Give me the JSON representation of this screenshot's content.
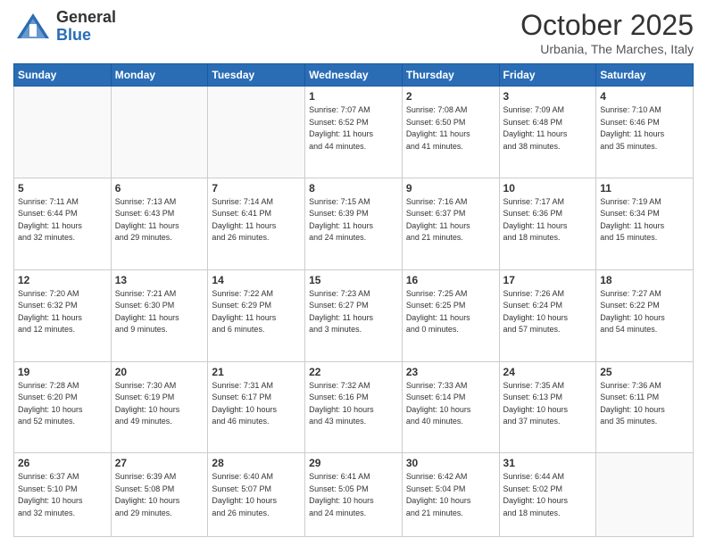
{
  "header": {
    "logo_general": "General",
    "logo_blue": "Blue",
    "month_title": "October 2025",
    "location": "Urbania, The Marches, Italy"
  },
  "days_of_week": [
    "Sunday",
    "Monday",
    "Tuesday",
    "Wednesday",
    "Thursday",
    "Friday",
    "Saturday"
  ],
  "weeks": [
    [
      {
        "day": "",
        "info": ""
      },
      {
        "day": "",
        "info": ""
      },
      {
        "day": "",
        "info": ""
      },
      {
        "day": "1",
        "info": "Sunrise: 7:07 AM\nSunset: 6:52 PM\nDaylight: 11 hours\nand 44 minutes."
      },
      {
        "day": "2",
        "info": "Sunrise: 7:08 AM\nSunset: 6:50 PM\nDaylight: 11 hours\nand 41 minutes."
      },
      {
        "day": "3",
        "info": "Sunrise: 7:09 AM\nSunset: 6:48 PM\nDaylight: 11 hours\nand 38 minutes."
      },
      {
        "day": "4",
        "info": "Sunrise: 7:10 AM\nSunset: 6:46 PM\nDaylight: 11 hours\nand 35 minutes."
      }
    ],
    [
      {
        "day": "5",
        "info": "Sunrise: 7:11 AM\nSunset: 6:44 PM\nDaylight: 11 hours\nand 32 minutes."
      },
      {
        "day": "6",
        "info": "Sunrise: 7:13 AM\nSunset: 6:43 PM\nDaylight: 11 hours\nand 29 minutes."
      },
      {
        "day": "7",
        "info": "Sunrise: 7:14 AM\nSunset: 6:41 PM\nDaylight: 11 hours\nand 26 minutes."
      },
      {
        "day": "8",
        "info": "Sunrise: 7:15 AM\nSunset: 6:39 PM\nDaylight: 11 hours\nand 24 minutes."
      },
      {
        "day": "9",
        "info": "Sunrise: 7:16 AM\nSunset: 6:37 PM\nDaylight: 11 hours\nand 21 minutes."
      },
      {
        "day": "10",
        "info": "Sunrise: 7:17 AM\nSunset: 6:36 PM\nDaylight: 11 hours\nand 18 minutes."
      },
      {
        "day": "11",
        "info": "Sunrise: 7:19 AM\nSunset: 6:34 PM\nDaylight: 11 hours\nand 15 minutes."
      }
    ],
    [
      {
        "day": "12",
        "info": "Sunrise: 7:20 AM\nSunset: 6:32 PM\nDaylight: 11 hours\nand 12 minutes."
      },
      {
        "day": "13",
        "info": "Sunrise: 7:21 AM\nSunset: 6:30 PM\nDaylight: 11 hours\nand 9 minutes."
      },
      {
        "day": "14",
        "info": "Sunrise: 7:22 AM\nSunset: 6:29 PM\nDaylight: 11 hours\nand 6 minutes."
      },
      {
        "day": "15",
        "info": "Sunrise: 7:23 AM\nSunset: 6:27 PM\nDaylight: 11 hours\nand 3 minutes."
      },
      {
        "day": "16",
        "info": "Sunrise: 7:25 AM\nSunset: 6:25 PM\nDaylight: 11 hours\nand 0 minutes."
      },
      {
        "day": "17",
        "info": "Sunrise: 7:26 AM\nSunset: 6:24 PM\nDaylight: 10 hours\nand 57 minutes."
      },
      {
        "day": "18",
        "info": "Sunrise: 7:27 AM\nSunset: 6:22 PM\nDaylight: 10 hours\nand 54 minutes."
      }
    ],
    [
      {
        "day": "19",
        "info": "Sunrise: 7:28 AM\nSunset: 6:20 PM\nDaylight: 10 hours\nand 52 minutes."
      },
      {
        "day": "20",
        "info": "Sunrise: 7:30 AM\nSunset: 6:19 PM\nDaylight: 10 hours\nand 49 minutes."
      },
      {
        "day": "21",
        "info": "Sunrise: 7:31 AM\nSunset: 6:17 PM\nDaylight: 10 hours\nand 46 minutes."
      },
      {
        "day": "22",
        "info": "Sunrise: 7:32 AM\nSunset: 6:16 PM\nDaylight: 10 hours\nand 43 minutes."
      },
      {
        "day": "23",
        "info": "Sunrise: 7:33 AM\nSunset: 6:14 PM\nDaylight: 10 hours\nand 40 minutes."
      },
      {
        "day": "24",
        "info": "Sunrise: 7:35 AM\nSunset: 6:13 PM\nDaylight: 10 hours\nand 37 minutes."
      },
      {
        "day": "25",
        "info": "Sunrise: 7:36 AM\nSunset: 6:11 PM\nDaylight: 10 hours\nand 35 minutes."
      }
    ],
    [
      {
        "day": "26",
        "info": "Sunrise: 6:37 AM\nSunset: 5:10 PM\nDaylight: 10 hours\nand 32 minutes."
      },
      {
        "day": "27",
        "info": "Sunrise: 6:39 AM\nSunset: 5:08 PM\nDaylight: 10 hours\nand 29 minutes."
      },
      {
        "day": "28",
        "info": "Sunrise: 6:40 AM\nSunset: 5:07 PM\nDaylight: 10 hours\nand 26 minutes."
      },
      {
        "day": "29",
        "info": "Sunrise: 6:41 AM\nSunset: 5:05 PM\nDaylight: 10 hours\nand 24 minutes."
      },
      {
        "day": "30",
        "info": "Sunrise: 6:42 AM\nSunset: 5:04 PM\nDaylight: 10 hours\nand 21 minutes."
      },
      {
        "day": "31",
        "info": "Sunrise: 6:44 AM\nSunset: 5:02 PM\nDaylight: 10 hours\nand 18 minutes."
      },
      {
        "day": "",
        "info": ""
      }
    ]
  ]
}
